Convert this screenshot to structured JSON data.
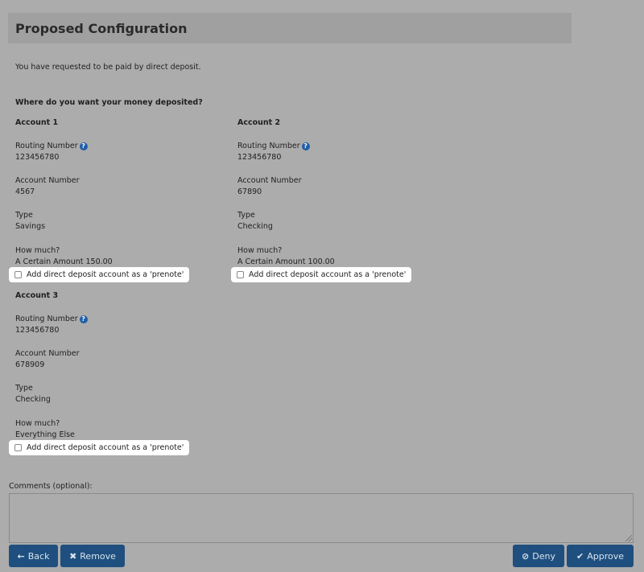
{
  "header": {
    "title": "Proposed Configuration"
  },
  "intro": "You have requested to be paid by direct deposit.",
  "question": "Where do you want your money deposited?",
  "labels": {
    "routing": "Routing Number",
    "account_number": "Account Number",
    "type": "Type",
    "how_much": "How much?",
    "prenote": "Add direct deposit account as a 'prenote'"
  },
  "accounts": [
    {
      "title": "Account 1",
      "routing": "123456780",
      "account_number": "4567",
      "type": "Savings",
      "how_much": "A Certain Amount 150.00"
    },
    {
      "title": "Account 2",
      "routing": "123456780",
      "account_number": "67890",
      "type": "Checking",
      "how_much": "A Certain Amount 100.00"
    },
    {
      "title": "Account 3",
      "routing": "123456780",
      "account_number": "678909",
      "type": "Checking",
      "how_much": "Everything Else"
    }
  ],
  "comments": {
    "label": "Comments (optional):",
    "value": ""
  },
  "buttons": {
    "back": "Back",
    "remove": "Remove",
    "deny": "Deny",
    "approve": "Approve"
  },
  "icons": {
    "back": "arrow-left-icon",
    "remove": "x-icon",
    "deny": "ban-icon",
    "approve": "check-icon",
    "help": "question-circle-icon"
  },
  "colors": {
    "button": "#1f4f7e",
    "help_icon": "#1f5fa8",
    "background": "#acacac"
  }
}
